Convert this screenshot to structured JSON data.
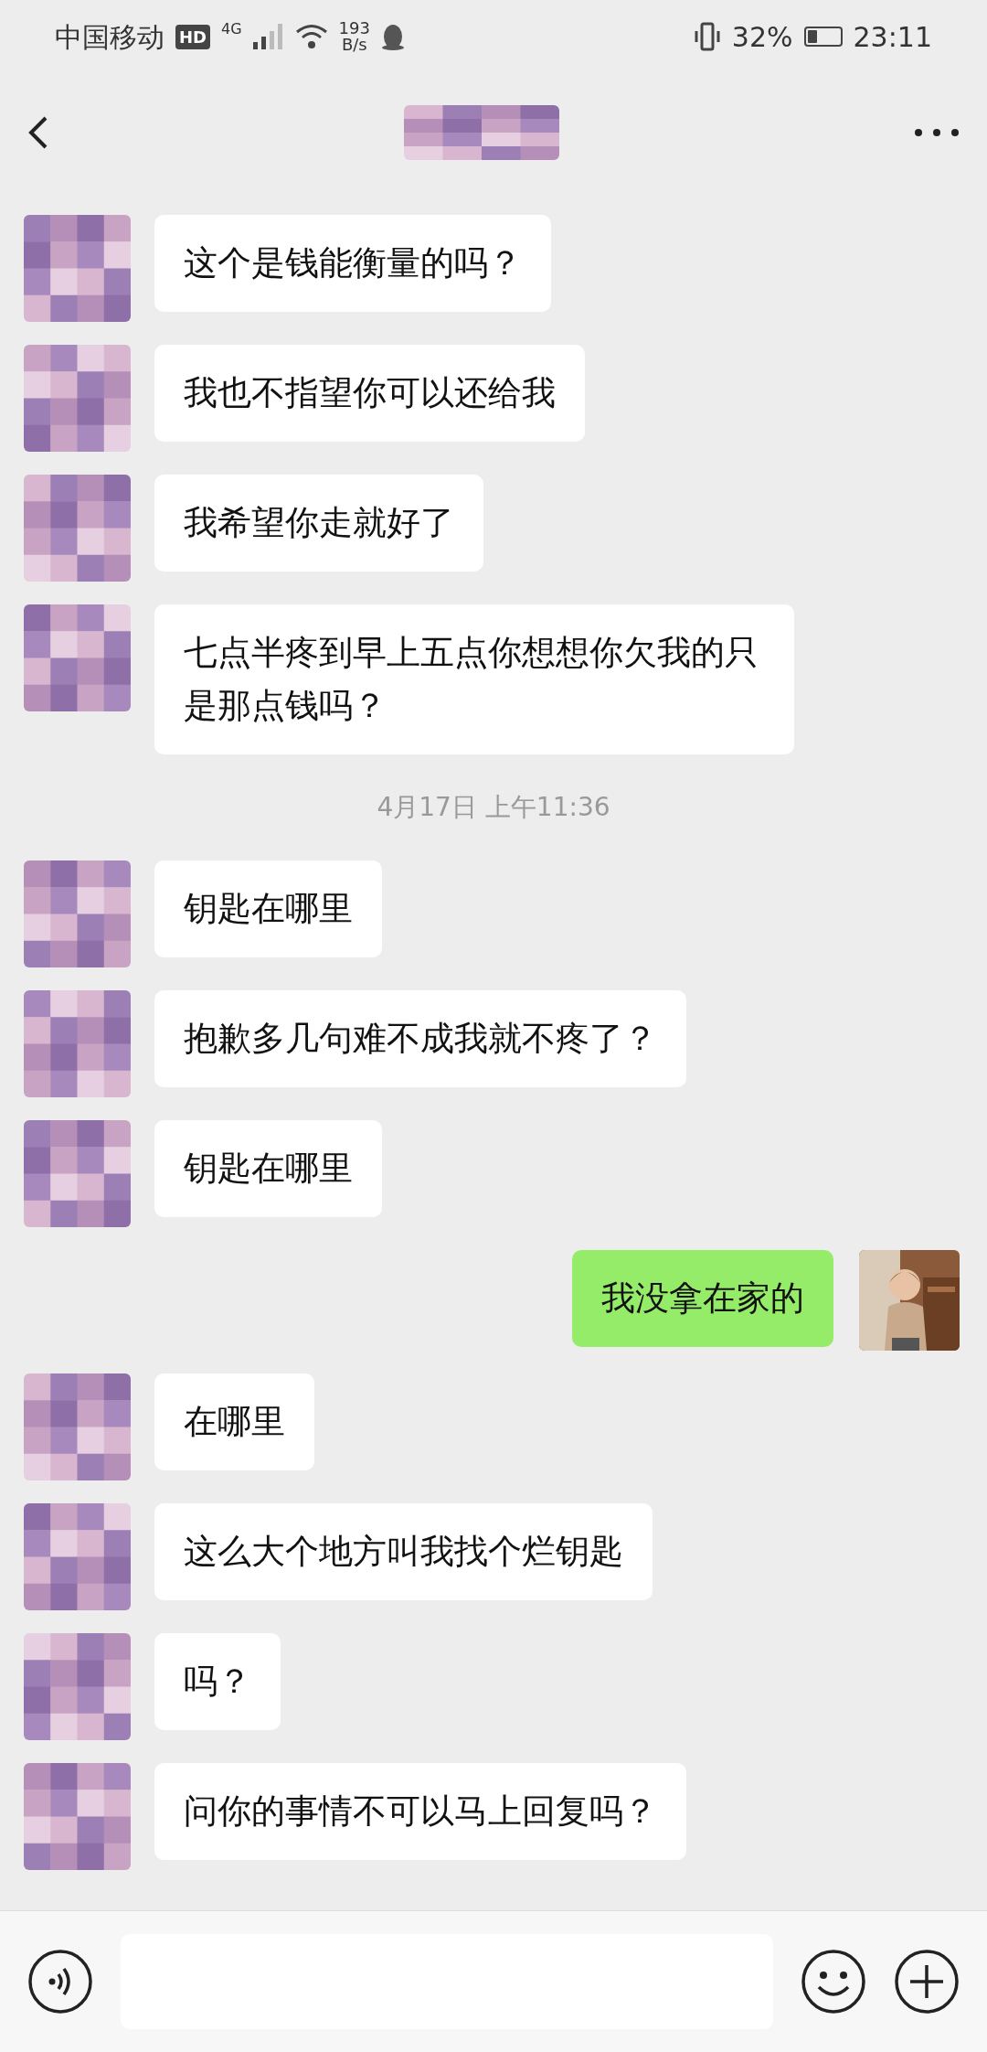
{
  "status_bar": {
    "carrier": "中国移动",
    "hd_badge": "HD",
    "network": "4G",
    "speed_value": "193",
    "speed_unit": "B/s",
    "battery": "32%",
    "time": "23:11"
  },
  "messages": [
    {
      "kind": "incoming",
      "text": "这个是钱能衡量的吗？"
    },
    {
      "kind": "incoming",
      "text": "我也不指望你可以还给我"
    },
    {
      "kind": "incoming",
      "text": "我希望你走就好了"
    },
    {
      "kind": "incoming",
      "text": "七点半疼到早上五点你想想你欠我的只是那点钱吗？"
    },
    {
      "kind": "time",
      "text": "4月17日 上午11:36"
    },
    {
      "kind": "incoming",
      "text": "钥匙在哪里"
    },
    {
      "kind": "incoming",
      "text": "抱歉多几句难不成我就不疼了？"
    },
    {
      "kind": "incoming",
      "text": "钥匙在哪里"
    },
    {
      "kind": "outgoing",
      "text": "我没拿在家的"
    },
    {
      "kind": "incoming",
      "text": "在哪里"
    },
    {
      "kind": "incoming",
      "text": "这么大个地方叫我找个烂钥匙"
    },
    {
      "kind": "incoming",
      "text": "吗？"
    },
    {
      "kind": "incoming",
      "text": "问你的事情不可以马上回复吗？"
    }
  ]
}
